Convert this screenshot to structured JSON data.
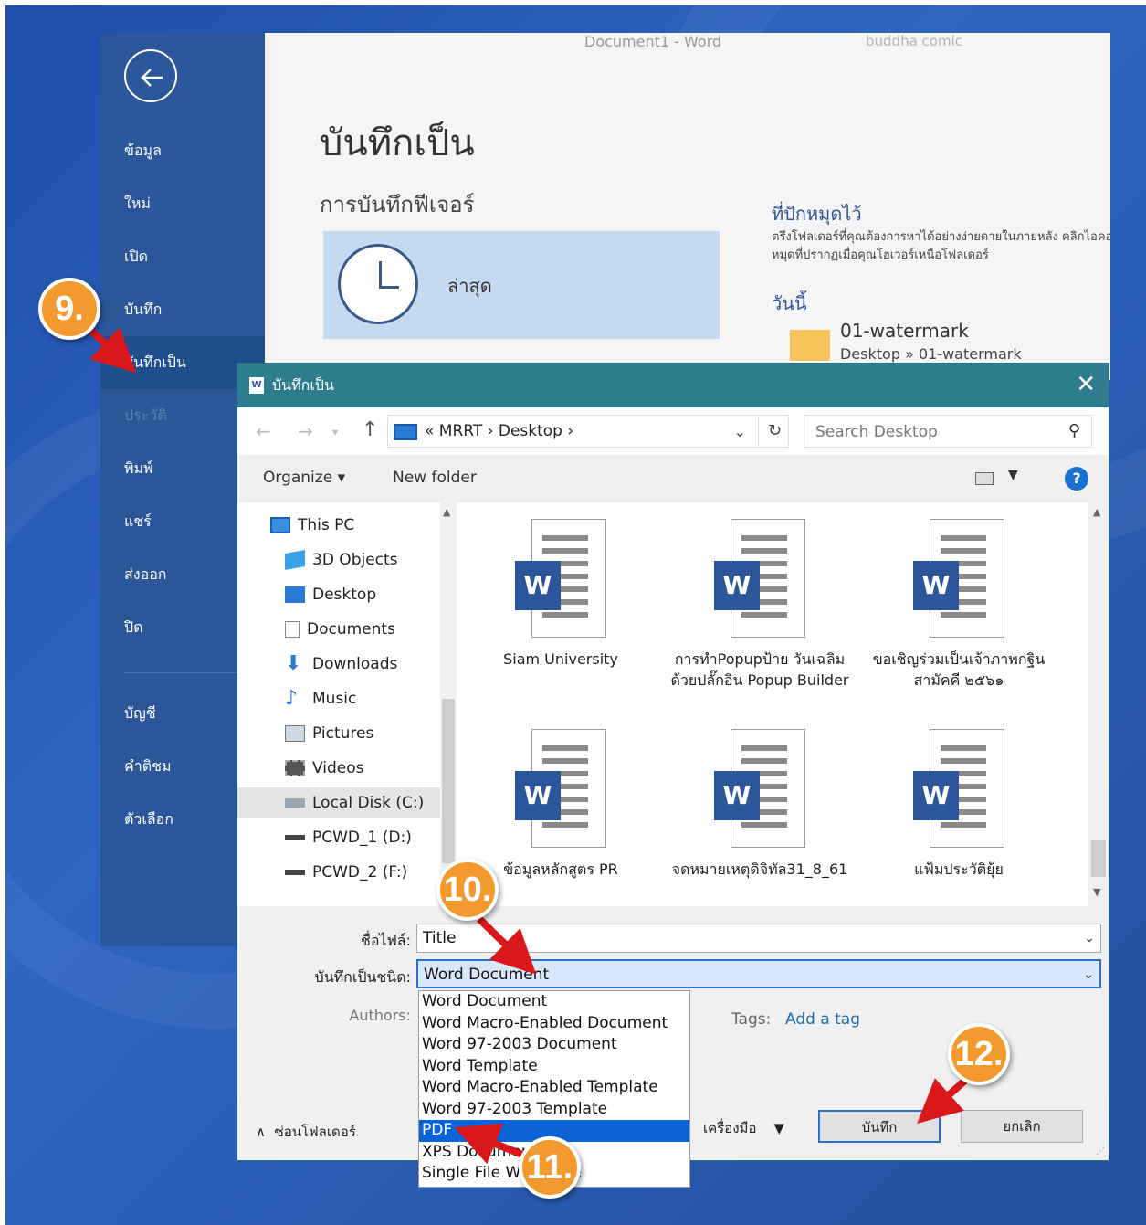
{
  "word": {
    "title_bar": "Document1 - Word",
    "user": "buddha comic",
    "nav": [
      {
        "label": "ข้อมูล"
      },
      {
        "label": "ใหม่"
      },
      {
        "label": "เปิด"
      },
      {
        "label": "บันทึก"
      },
      {
        "label": "บันทึกเป็น"
      },
      {
        "label": "ประวัติ"
      },
      {
        "label": "พิมพ์"
      },
      {
        "label": "แชร์"
      },
      {
        "label": "ส่งออก"
      },
      {
        "label": "ปิด"
      },
      {
        "label": "บัญชี"
      },
      {
        "label": "คำติชม"
      },
      {
        "label": "ตัวเลือก"
      }
    ],
    "page_title": "บันทึกเป็น",
    "features_title": "การบันทึกฟีเจอร์",
    "recent_label": "ล่าสุด",
    "pinned_title": "ที่ปักหมุดไว้",
    "pinned_desc": "ตรึงโฟลเดอร์ที่คุณต้องการหาได้อย่างง่ายดายในภายหลัง คลิกไอคอนปักหมุดที่ปรากฏเมื่อคุณโฮเวอร์เหนือโฟลเดอร์",
    "today_label": "วันนี้",
    "recent_folder": {
      "name": "01-watermark",
      "path": "Desktop » 01-watermark"
    }
  },
  "dialog": {
    "title": "บันทึกเป็น",
    "breadcrumb": "«  MRRT  ›  Desktop  ›",
    "search_placeholder": "Search Desktop",
    "organize_label": "Organize ▾",
    "new_folder_label": "New folder",
    "help_label": "?",
    "tree": [
      {
        "label": "This PC",
        "icon": "pc-icon"
      },
      {
        "label": "3D Objects",
        "icon": "cube-icon"
      },
      {
        "label": "Desktop",
        "icon": "desktop-icon"
      },
      {
        "label": "Documents",
        "icon": "documents-icon"
      },
      {
        "label": "Downloads",
        "icon": "download-icon"
      },
      {
        "label": "Music",
        "icon": "music-icon"
      },
      {
        "label": "Pictures",
        "icon": "pictures-icon"
      },
      {
        "label": "Videos",
        "icon": "videos-icon"
      },
      {
        "label": "Local Disk (C:)",
        "icon": "disk-icon"
      },
      {
        "label": "PCWD_1 (D:)",
        "icon": "drive-icon"
      },
      {
        "label": "PCWD_2 (F:)",
        "icon": "drive-icon"
      }
    ],
    "files": [
      {
        "name": "Siam University"
      },
      {
        "name": "การทำPopupป้าย วันเฉลิม ด้วยปลั๊กอิน Popup Builder"
      },
      {
        "name": "ขอเชิญร่วมเป็นเจ้าภาพกฐินสามัคคี ๒๕๖๑"
      },
      {
        "name": "ข้อมูลหลักสูตร PR"
      },
      {
        "name": "จดหมายเหตุดิจิทัล31_8_61"
      },
      {
        "name": "แฟ้มประวัติยุ้ย"
      }
    ],
    "filename_label": "ชื่อไฟล์:",
    "filename_value": "Title",
    "savetype_label": "บันทึกเป็นชนิด:",
    "savetype_value": "Word Document",
    "authors_label": "Authors:",
    "tags_label": "Tags:",
    "tags_add": "Add a tag",
    "save_types": [
      "Word Document",
      "Word Macro-Enabled Document",
      "Word 97-2003 Document",
      "Word Template",
      "Word Macro-Enabled Template",
      "Word 97-2003 Template",
      "PDF",
      "XPS Document",
      "Single File Web Page"
    ],
    "hide_folders": "ซ่อนโฟลเดอร์",
    "tools_label": "เครื่องมือ",
    "save_button": "บันทึก",
    "cancel_button": "ยกเลิก"
  },
  "steps": [
    "9.",
    "10.",
    "11.",
    "12."
  ],
  "colors": {
    "word_blue": "#2b579a",
    "dialog_teal": "#2e7d8e",
    "marker_orange": "#f29a2e",
    "arrow_red": "#d9181b",
    "highlight": "#0c63d6"
  }
}
